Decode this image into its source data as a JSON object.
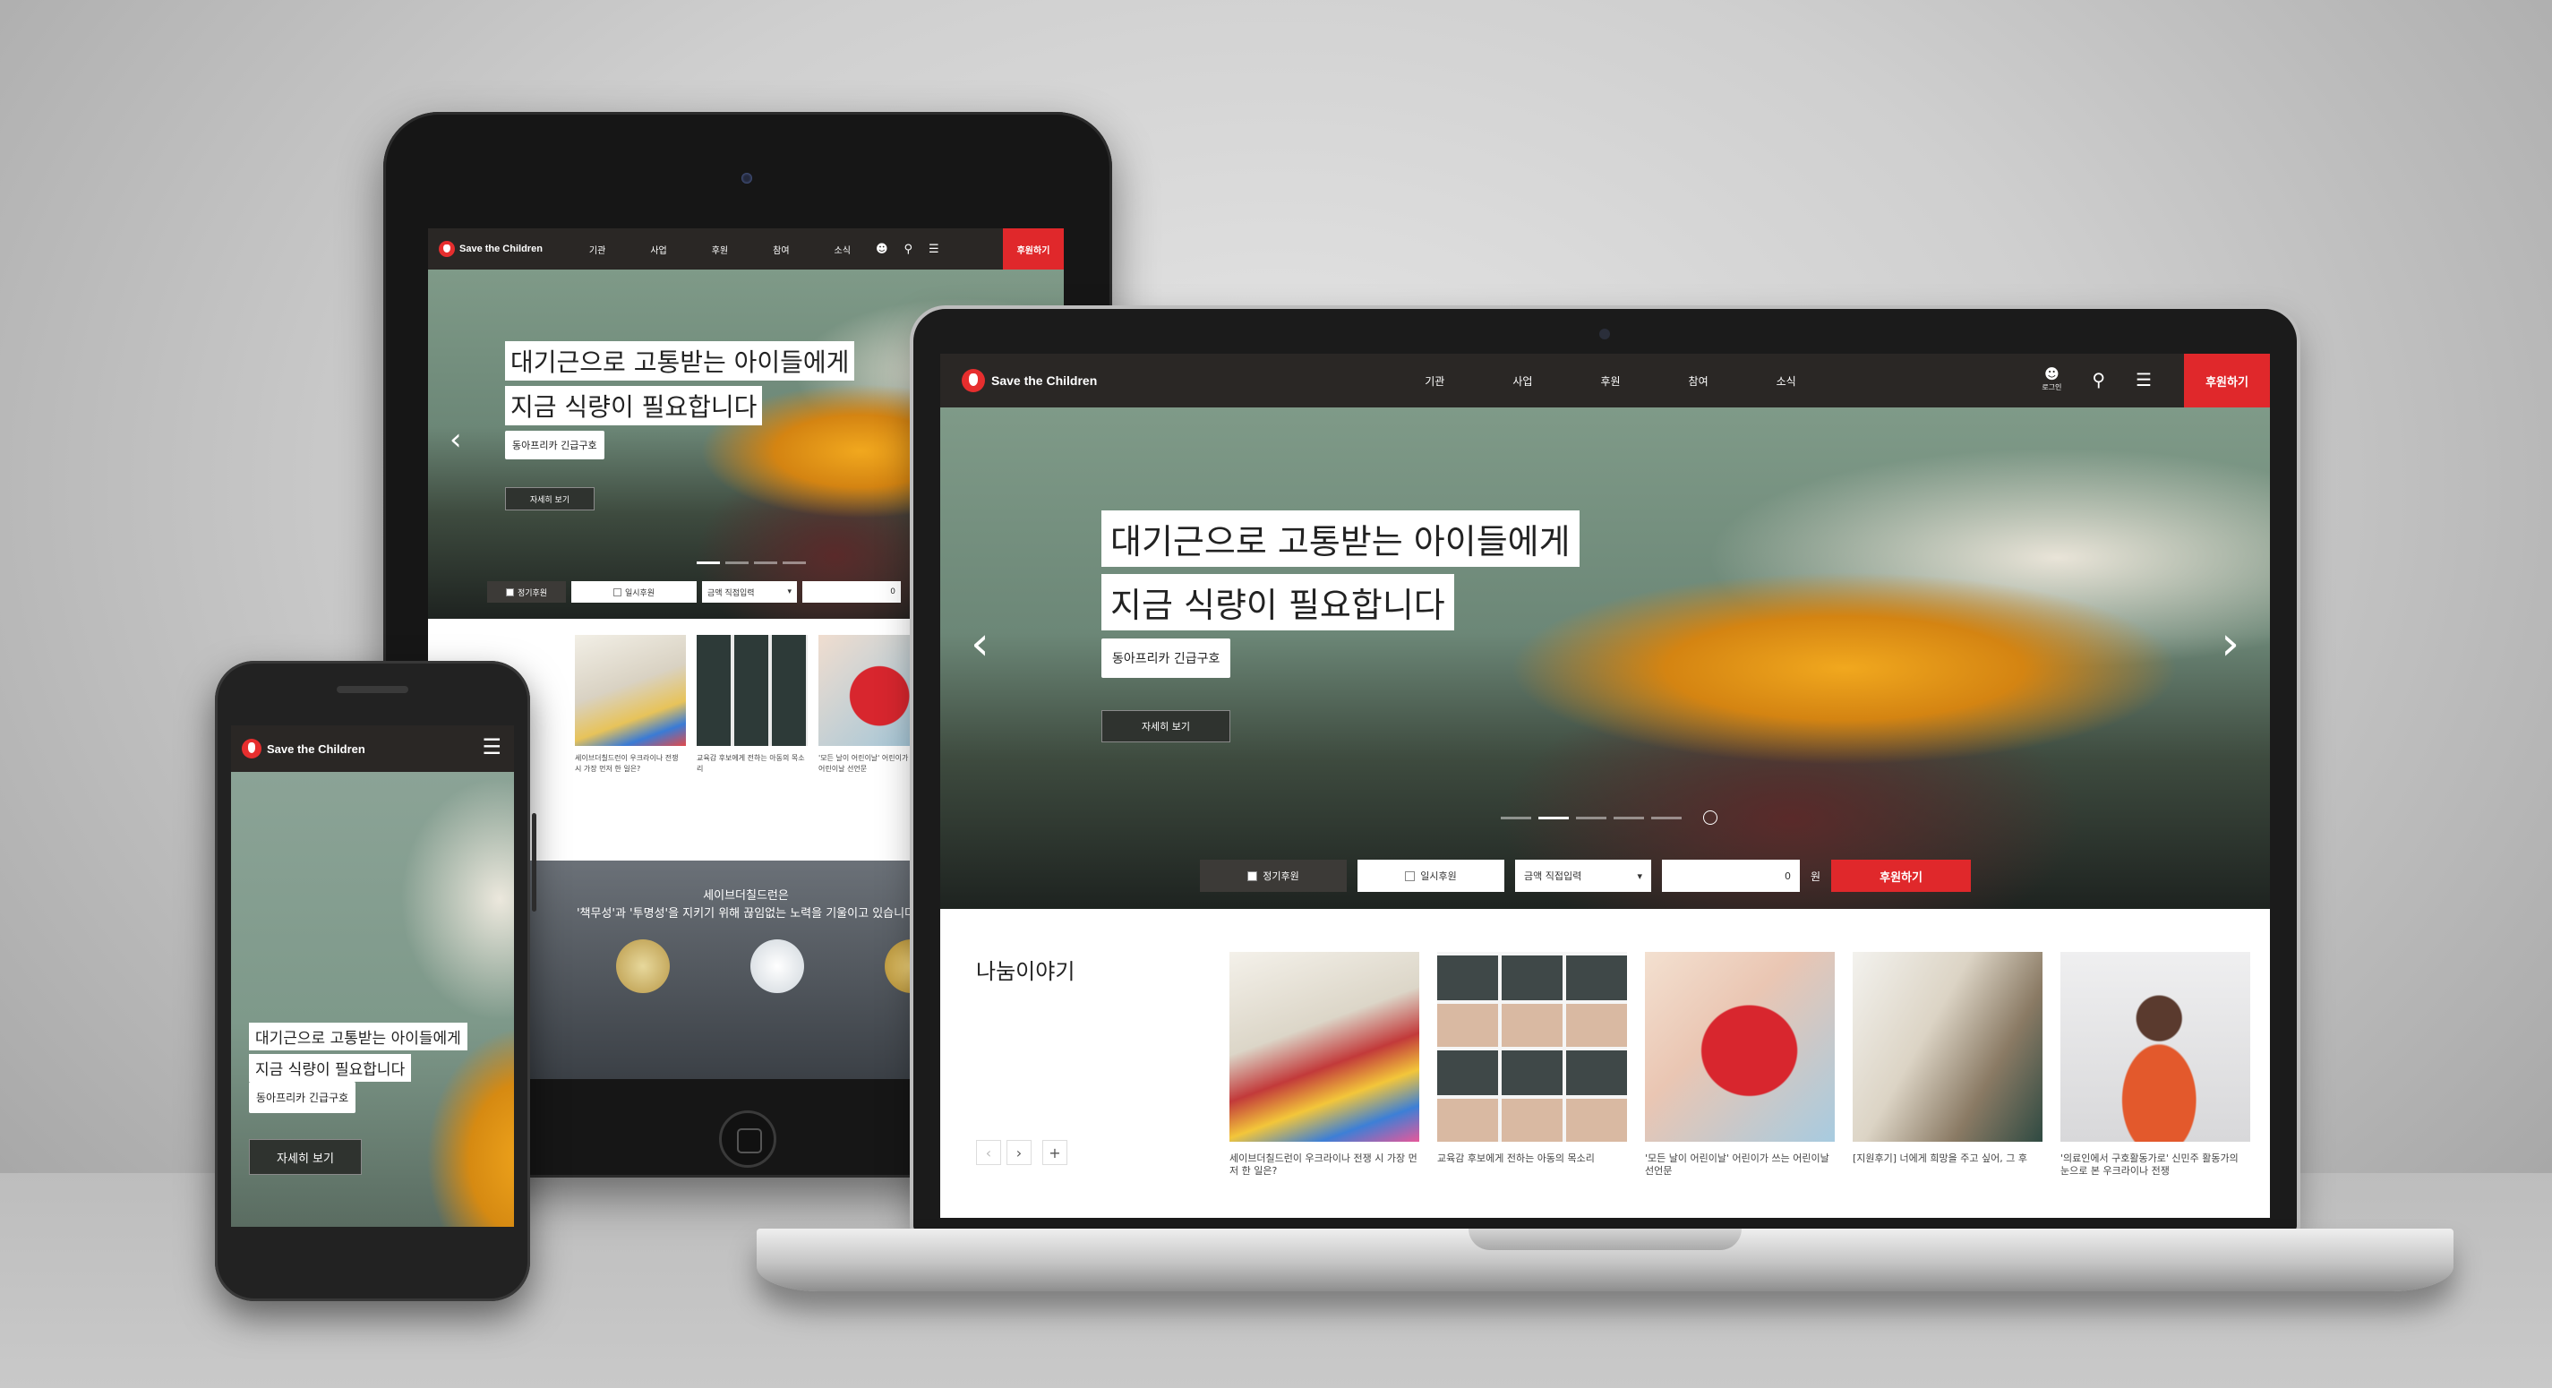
{
  "brand": {
    "name": "Save the Children",
    "accent": "#e0282b",
    "nav_bg": "#2a2725"
  },
  "nav": {
    "menu": [
      "기관",
      "사업",
      "후원",
      "참여",
      "소식"
    ],
    "login_label": "로그인",
    "donate_label": "후원하기",
    "icons": [
      "user-icon",
      "search-icon",
      "hamburger-icon"
    ]
  },
  "hero": {
    "title_line1": "대기근으로 고통받는 아이들에게",
    "title_line2": "지금 식량이 필요합니다",
    "tag": "동아프리카 긴급구호",
    "more_tablet": "자세히 보기",
    "more_phone": "자세히 보기",
    "more_laptop": "자세히 보기"
  },
  "donation_bar": {
    "regular": "정기후원",
    "onetime": "일시후원",
    "amount_select": "금액 직접입력",
    "amount_value": "0",
    "unit": "원",
    "submit": "후원하기"
  },
  "stories": {
    "title": "나눔이야기",
    "items": [
      {
        "caption": "세이브더칠드런이 우크라이나 전쟁 시 가장 먼저 한 일은?"
      },
      {
        "caption": "교육감 후보에게 전하는 아동의 목소리"
      },
      {
        "caption": "'모든 날이 어린이날' 어린이가 쓰는 어린이날 선언문"
      },
      {
        "caption": "[지원후기] 너에게 희망을 주고 싶어, 그 후"
      },
      {
        "caption": "'의료인에서 구호활동가로' 신민주 활동가의 눈으로 본 우크라이나 전쟁"
      }
    ]
  },
  "tablet_trust": {
    "line1": "세이브더칠드런은",
    "line2": "'책무성'과 '투명성'을 지키기 위해 끊임없는 노력을 기울이고 있습니다"
  }
}
